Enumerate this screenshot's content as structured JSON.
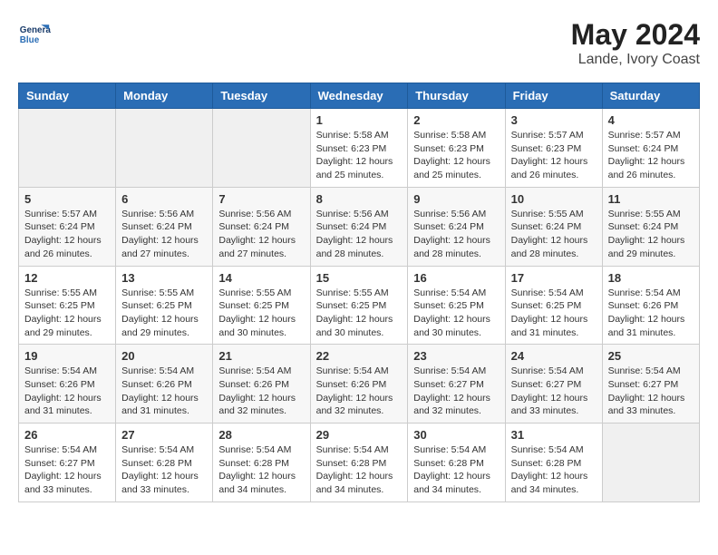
{
  "header": {
    "logo_general": "General",
    "logo_blue": "Blue",
    "month_year": "May 2024",
    "location": "Lande, Ivory Coast"
  },
  "weekdays": [
    "Sunday",
    "Monday",
    "Tuesday",
    "Wednesday",
    "Thursday",
    "Friday",
    "Saturday"
  ],
  "weeks": [
    [
      {
        "day": "",
        "info": ""
      },
      {
        "day": "",
        "info": ""
      },
      {
        "day": "",
        "info": ""
      },
      {
        "day": "1",
        "info": "Sunrise: 5:58 AM\nSunset: 6:23 PM\nDaylight: 12 hours\nand 25 minutes."
      },
      {
        "day": "2",
        "info": "Sunrise: 5:58 AM\nSunset: 6:23 PM\nDaylight: 12 hours\nand 25 minutes."
      },
      {
        "day": "3",
        "info": "Sunrise: 5:57 AM\nSunset: 6:23 PM\nDaylight: 12 hours\nand 26 minutes."
      },
      {
        "day": "4",
        "info": "Sunrise: 5:57 AM\nSunset: 6:24 PM\nDaylight: 12 hours\nand 26 minutes."
      }
    ],
    [
      {
        "day": "5",
        "info": "Sunrise: 5:57 AM\nSunset: 6:24 PM\nDaylight: 12 hours\nand 26 minutes."
      },
      {
        "day": "6",
        "info": "Sunrise: 5:56 AM\nSunset: 6:24 PM\nDaylight: 12 hours\nand 27 minutes."
      },
      {
        "day": "7",
        "info": "Sunrise: 5:56 AM\nSunset: 6:24 PM\nDaylight: 12 hours\nand 27 minutes."
      },
      {
        "day": "8",
        "info": "Sunrise: 5:56 AM\nSunset: 6:24 PM\nDaylight: 12 hours\nand 28 minutes."
      },
      {
        "day": "9",
        "info": "Sunrise: 5:56 AM\nSunset: 6:24 PM\nDaylight: 12 hours\nand 28 minutes."
      },
      {
        "day": "10",
        "info": "Sunrise: 5:55 AM\nSunset: 6:24 PM\nDaylight: 12 hours\nand 28 minutes."
      },
      {
        "day": "11",
        "info": "Sunrise: 5:55 AM\nSunset: 6:24 PM\nDaylight: 12 hours\nand 29 minutes."
      }
    ],
    [
      {
        "day": "12",
        "info": "Sunrise: 5:55 AM\nSunset: 6:25 PM\nDaylight: 12 hours\nand 29 minutes."
      },
      {
        "day": "13",
        "info": "Sunrise: 5:55 AM\nSunset: 6:25 PM\nDaylight: 12 hours\nand 29 minutes."
      },
      {
        "day": "14",
        "info": "Sunrise: 5:55 AM\nSunset: 6:25 PM\nDaylight: 12 hours\nand 30 minutes."
      },
      {
        "day": "15",
        "info": "Sunrise: 5:55 AM\nSunset: 6:25 PM\nDaylight: 12 hours\nand 30 minutes."
      },
      {
        "day": "16",
        "info": "Sunrise: 5:54 AM\nSunset: 6:25 PM\nDaylight: 12 hours\nand 30 minutes."
      },
      {
        "day": "17",
        "info": "Sunrise: 5:54 AM\nSunset: 6:25 PM\nDaylight: 12 hours\nand 31 minutes."
      },
      {
        "day": "18",
        "info": "Sunrise: 5:54 AM\nSunset: 6:26 PM\nDaylight: 12 hours\nand 31 minutes."
      }
    ],
    [
      {
        "day": "19",
        "info": "Sunrise: 5:54 AM\nSunset: 6:26 PM\nDaylight: 12 hours\nand 31 minutes."
      },
      {
        "day": "20",
        "info": "Sunrise: 5:54 AM\nSunset: 6:26 PM\nDaylight: 12 hours\nand 31 minutes."
      },
      {
        "day": "21",
        "info": "Sunrise: 5:54 AM\nSunset: 6:26 PM\nDaylight: 12 hours\nand 32 minutes."
      },
      {
        "day": "22",
        "info": "Sunrise: 5:54 AM\nSunset: 6:26 PM\nDaylight: 12 hours\nand 32 minutes."
      },
      {
        "day": "23",
        "info": "Sunrise: 5:54 AM\nSunset: 6:27 PM\nDaylight: 12 hours\nand 32 minutes."
      },
      {
        "day": "24",
        "info": "Sunrise: 5:54 AM\nSunset: 6:27 PM\nDaylight: 12 hours\nand 33 minutes."
      },
      {
        "day": "25",
        "info": "Sunrise: 5:54 AM\nSunset: 6:27 PM\nDaylight: 12 hours\nand 33 minutes."
      }
    ],
    [
      {
        "day": "26",
        "info": "Sunrise: 5:54 AM\nSunset: 6:27 PM\nDaylight: 12 hours\nand 33 minutes."
      },
      {
        "day": "27",
        "info": "Sunrise: 5:54 AM\nSunset: 6:28 PM\nDaylight: 12 hours\nand 33 minutes."
      },
      {
        "day": "28",
        "info": "Sunrise: 5:54 AM\nSunset: 6:28 PM\nDaylight: 12 hours\nand 34 minutes."
      },
      {
        "day": "29",
        "info": "Sunrise: 5:54 AM\nSunset: 6:28 PM\nDaylight: 12 hours\nand 34 minutes."
      },
      {
        "day": "30",
        "info": "Sunrise: 5:54 AM\nSunset: 6:28 PM\nDaylight: 12 hours\nand 34 minutes."
      },
      {
        "day": "31",
        "info": "Sunrise: 5:54 AM\nSunset: 6:28 PM\nDaylight: 12 hours\nand 34 minutes."
      },
      {
        "day": "",
        "info": ""
      }
    ]
  ]
}
